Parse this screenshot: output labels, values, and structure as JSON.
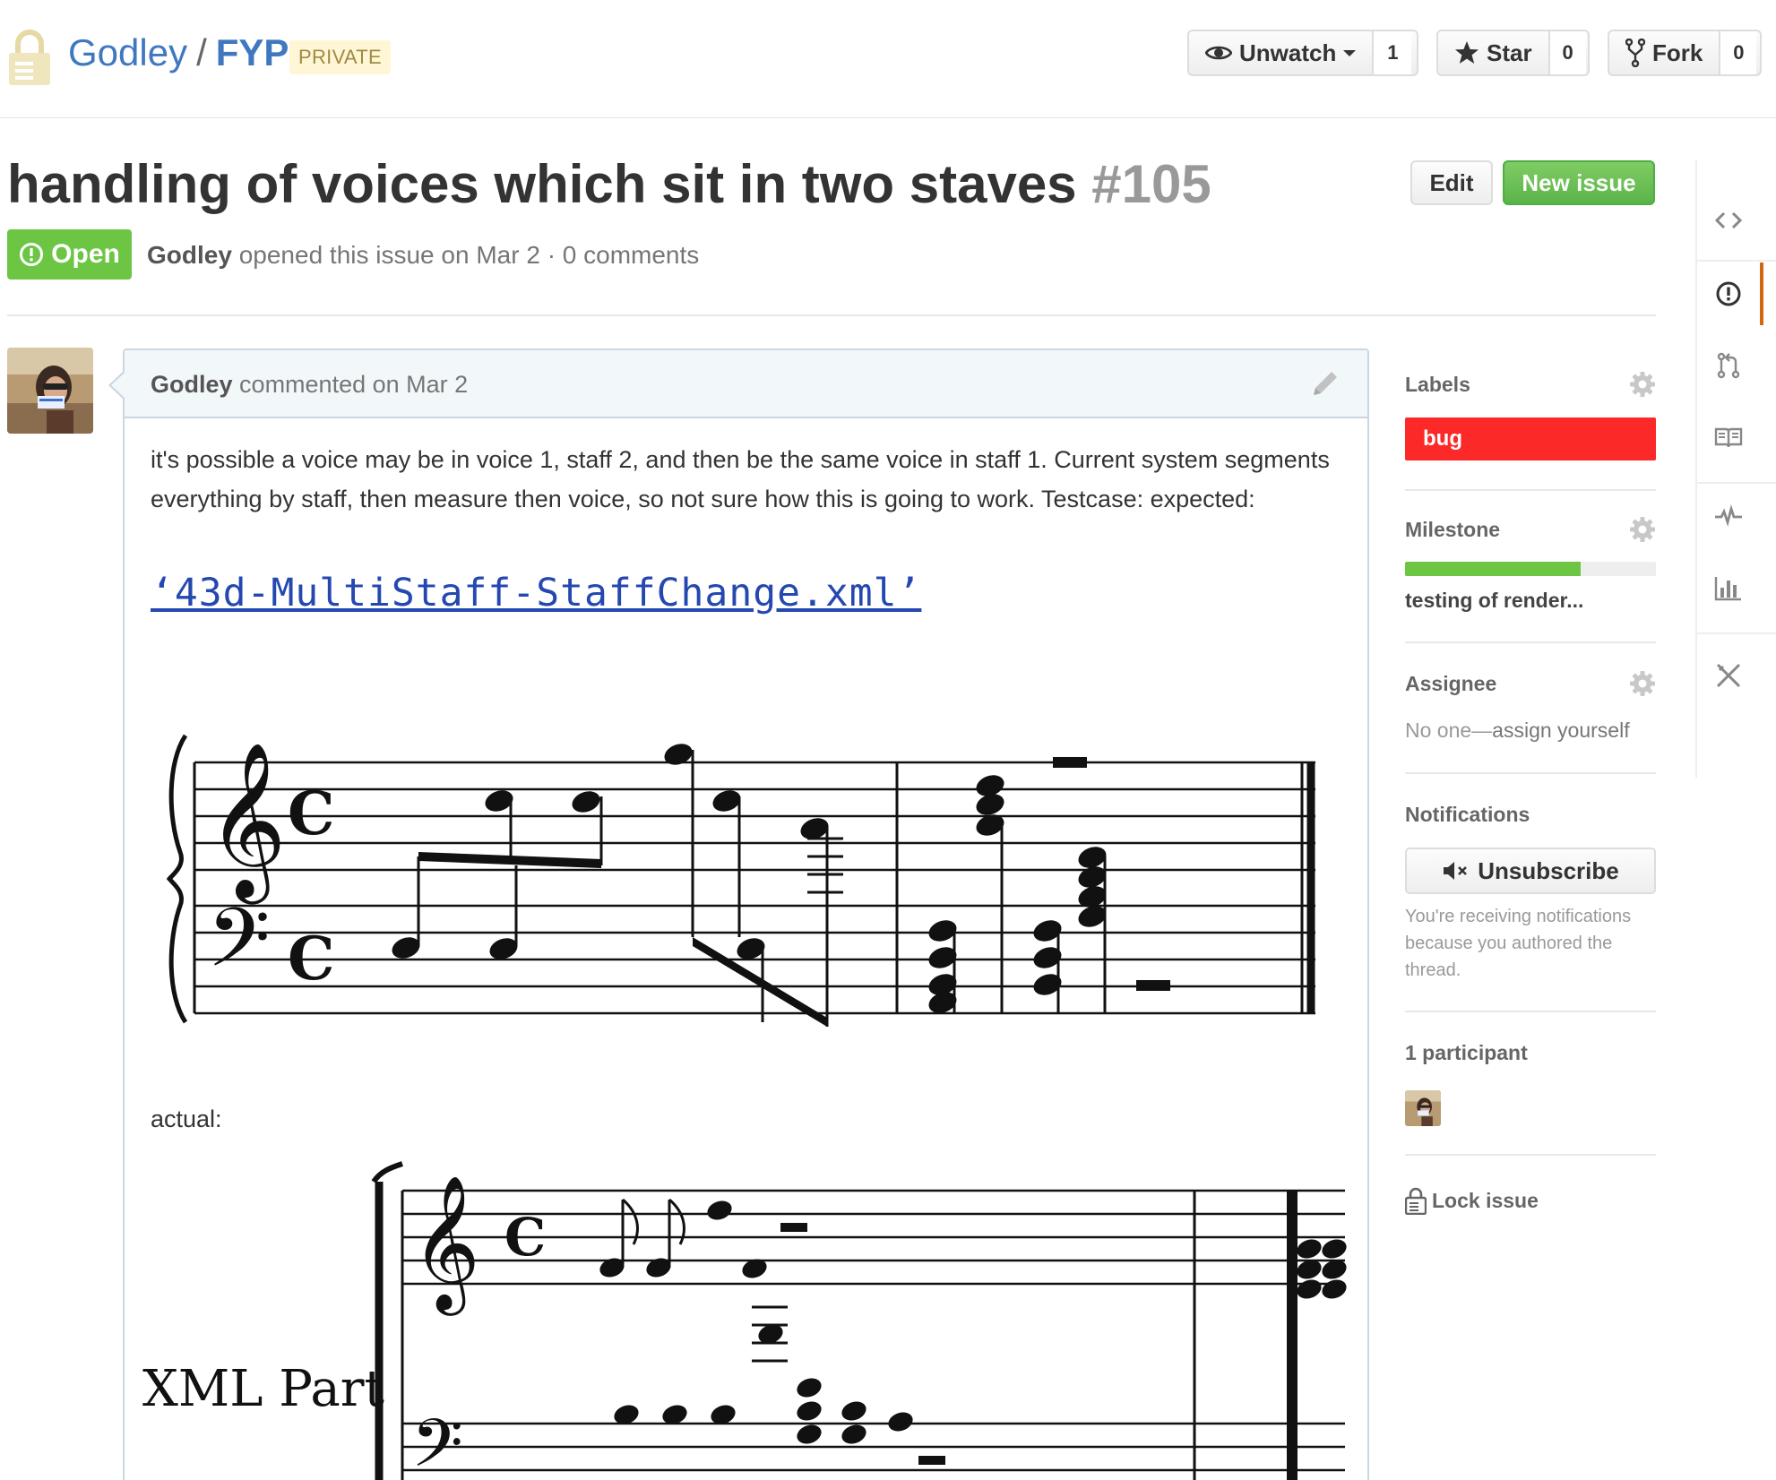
{
  "repo": {
    "owner": "Godley",
    "separator": "/",
    "name": "FYP",
    "visibility": "PRIVATE"
  },
  "actions": {
    "watch_label": "Unwatch",
    "watch_count": "1",
    "star_label": "Star",
    "star_count": "0",
    "fork_label": "Fork",
    "fork_count": "0"
  },
  "issue": {
    "title": "handling of voices which sit in two staves",
    "number": "#105",
    "state": "Open",
    "author": "Godley",
    "meta": "opened this issue on Mar 2 · 0 comments",
    "edit_label": "Edit",
    "new_issue_label": "New issue"
  },
  "comment": {
    "author": "Godley",
    "meta": "commented on Mar 2",
    "body": "it's possible a voice may be in voice 1, staff 2, and then be the same voice in staff 1. Current system segments everything by staff, then measure then voice, so not sure how this is going to work. Testcase: expected:",
    "link_text": "‘43d-MultiStaff-StaffChange.xml’",
    "actual_label": "actual:",
    "score_part_label": "XML Part"
  },
  "sidebar": {
    "labels_heading": "Labels",
    "label_name": "bug",
    "label_color": "#fc2929",
    "milestone_heading": "Milestone",
    "milestone_progress": 0.7,
    "milestone_name": "testing of render...",
    "assignee_heading": "Assignee",
    "assignee_none": "No one—",
    "assignee_link": "assign yourself",
    "notifications_heading": "Notifications",
    "unsubscribe_label": "Unsubscribe",
    "notifications_reason": "You're receiving notifications because you authored the thread.",
    "participants_heading": "1 participant",
    "lock_label": "Lock issue"
  },
  "repo_nav": [
    "code-icon",
    "issues-icon",
    "pull-request-icon",
    "wiki-icon",
    "pulse-icon",
    "graphs-icon",
    "settings-icon"
  ],
  "colors": {
    "link": "#4078c0",
    "open_green": "#6cc644",
    "new_issue_green": "#5bb449",
    "nav_selected": "#d26911"
  }
}
